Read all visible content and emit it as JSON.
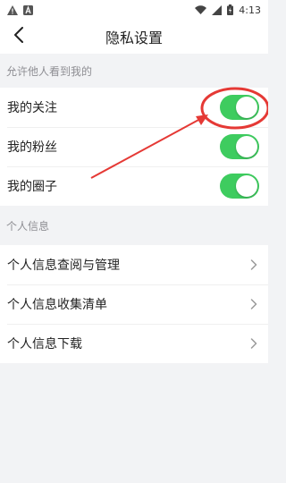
{
  "status_bar": {
    "time": "4:13",
    "left_icons": [
      "warning-icon",
      "a-square-icon"
    ],
    "right_icons": [
      "wifi-icon",
      "signal-icon",
      "battery-charging-icon"
    ]
  },
  "nav": {
    "title": "隐私设置",
    "back_icon": "chevron-left-icon"
  },
  "sections": {
    "visibility": {
      "header": "允许他人看到我的",
      "items": [
        {
          "label": "我的关注",
          "on": true
        },
        {
          "label": "我的粉丝",
          "on": true
        },
        {
          "label": "我的圈子",
          "on": true
        }
      ]
    },
    "personal": {
      "header": "个人信息",
      "items": [
        {
          "label": "个人信息查阅与管理"
        },
        {
          "label": "个人信息收集清单"
        },
        {
          "label": "个人信息下载"
        }
      ]
    }
  },
  "colors": {
    "toggle_on": "#3ecc5f",
    "annotation": "#e53935",
    "background": "#f2f3f5"
  }
}
